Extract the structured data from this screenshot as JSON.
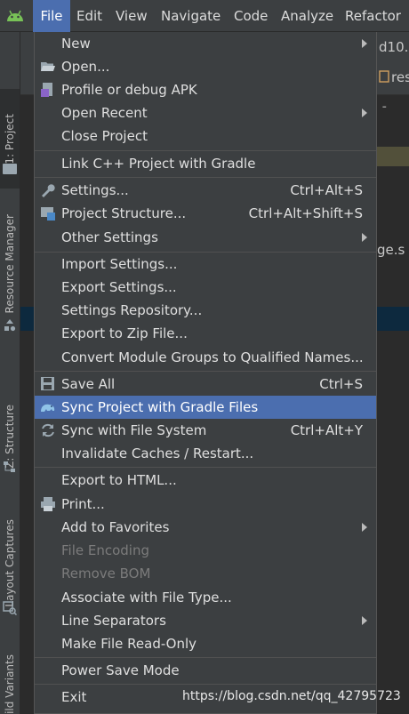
{
  "menubar": {
    "items": [
      {
        "label": "File",
        "active": true
      },
      {
        "label": "Edit"
      },
      {
        "label": "View"
      },
      {
        "label": "Navigate"
      },
      {
        "label": "Code"
      },
      {
        "label": "Analyze"
      },
      {
        "label": "Refactor"
      }
    ]
  },
  "left_tabs": [
    {
      "label": "1: Project"
    },
    {
      "label": "Resource Manager"
    },
    {
      "label": "Z: Structure"
    },
    {
      "label": "Layout Captures"
    },
    {
      "label": "ild Variants"
    }
  ],
  "background": {
    "tab_text": "d10.",
    "res_text": "res",
    "file_text": "ge.s"
  },
  "file_menu": {
    "items": [
      {
        "label": "New"
      },
      {
        "label": "Open...",
        "icon": "folder-open-icon"
      },
      {
        "label": "Profile or debug APK",
        "icon": "apk-icon"
      },
      {
        "label": "Open Recent"
      },
      {
        "label": "Close Project"
      },
      {
        "label": "Link C++ Project with Gradle"
      },
      {
        "label": "Settings...",
        "shortcut": "Ctrl+Alt+S",
        "icon": "wrench-icon"
      },
      {
        "label": "Project Structure...",
        "shortcut": "Ctrl+Alt+Shift+S",
        "icon": "project-structure-icon"
      },
      {
        "label": "Other Settings"
      },
      {
        "label": "Import Settings..."
      },
      {
        "label": "Export Settings..."
      },
      {
        "label": "Settings Repository..."
      },
      {
        "label": "Export to Zip File..."
      },
      {
        "label": "Convert Module Groups to Qualified Names..."
      },
      {
        "label": "Save All",
        "shortcut": "Ctrl+S",
        "icon": "save-icon"
      },
      {
        "label": "Sync Project with Gradle Files",
        "icon": "gradle-elephant-icon"
      },
      {
        "label": "Sync with File System",
        "shortcut": "Ctrl+Alt+Y",
        "icon": "sync-icon"
      },
      {
        "label": "Invalidate Caches / Restart..."
      },
      {
        "label": "Export to HTML..."
      },
      {
        "label": "Print...",
        "icon": "printer-icon"
      },
      {
        "label": "Add to Favorites"
      },
      {
        "label": "File Encoding",
        "disabled": true
      },
      {
        "label": "Remove BOM",
        "disabled": true
      },
      {
        "label": "Associate with File Type..."
      },
      {
        "label": "Line Separators"
      },
      {
        "label": "Make File Read-Only"
      },
      {
        "label": "Power Save Mode"
      },
      {
        "label": "Exit"
      }
    ]
  },
  "watermark": "https://blog.csdn.net/qq_42795723"
}
